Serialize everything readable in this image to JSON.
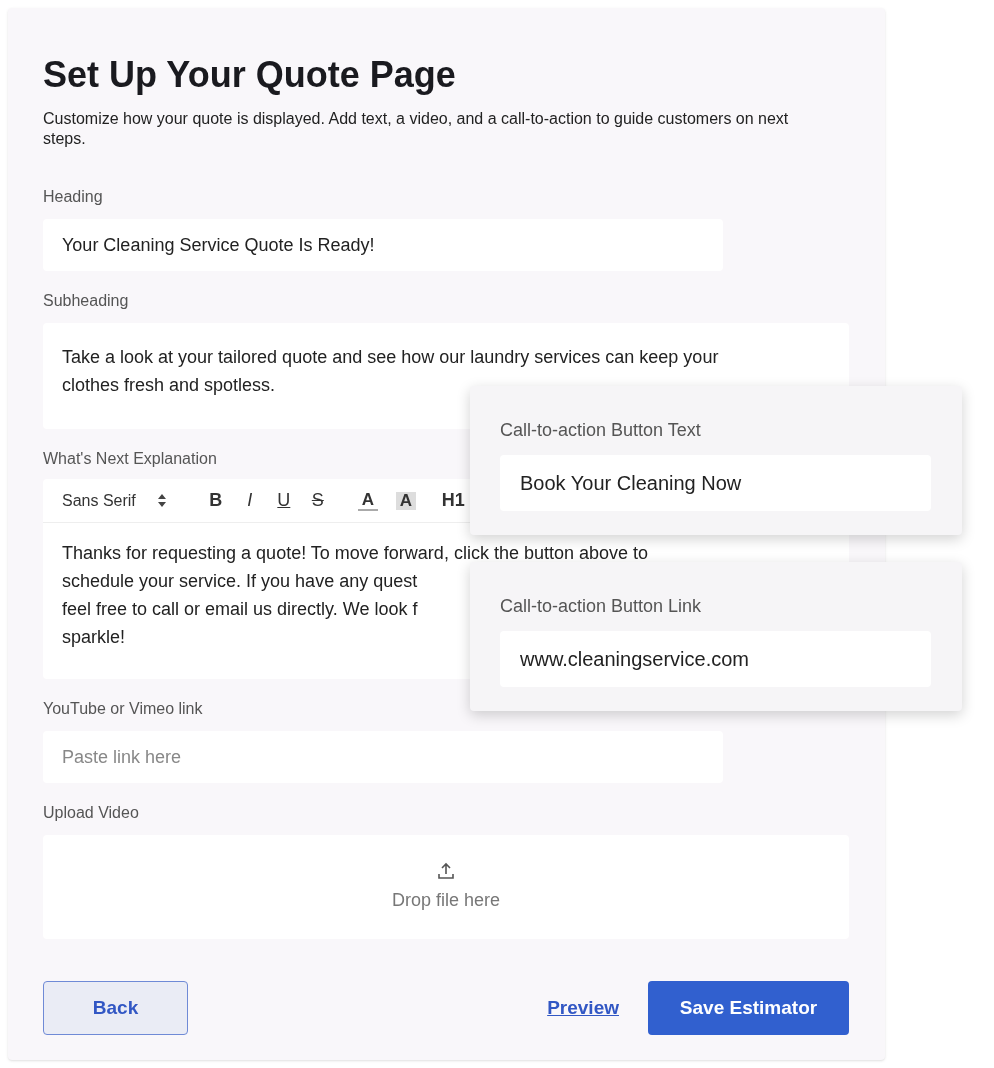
{
  "title": "Set Up Your Quote Page",
  "description": "Customize how your quote is displayed. Add text, a video, and a call-to-action to guide customers on next steps.",
  "heading_field": {
    "label": "Heading",
    "value": "Your Cleaning Service Quote Is Ready!"
  },
  "subheading_field": {
    "label": "Subheading",
    "value": "Take a look at your tailored quote and see how our laundry services can keep your clothes fresh and spotless."
  },
  "explanation_editor": {
    "label": "What's Next Explanation",
    "toolbar": [
      {
        "kind": "font",
        "text": "Sans Serif"
      },
      {
        "kind": "bold",
        "text": "B"
      },
      {
        "kind": "italic",
        "text": "I"
      },
      {
        "kind": "underline",
        "text": "U"
      },
      {
        "kind": "strike",
        "text": "S"
      },
      {
        "kind": "color",
        "text": "A"
      },
      {
        "kind": "highlight",
        "text": "A"
      },
      {
        "kind": "heading",
        "text": "H1"
      }
    ],
    "lines": [
      "Thanks for requesting a quote! To move forward, click the button above to",
      "schedule your service. If you have any quest",
      "feel free to call or email us directly. We look f",
      "sparkle!"
    ]
  },
  "video_link_field": {
    "label": "YouTube or Vimeo link",
    "placeholder": "Paste link here"
  },
  "upload": {
    "label": "Upload Video",
    "text": "Drop file here"
  },
  "buttons": {
    "back": "Back",
    "preview": "Preview",
    "save": "Save Estimator"
  },
  "cta_cards": [
    {
      "label": "Call-to-action Button Text",
      "value": "Book Your Cleaning Now"
    },
    {
      "label": "Call-to-action Button Link",
      "value": "www.cleaningservice.com"
    }
  ]
}
